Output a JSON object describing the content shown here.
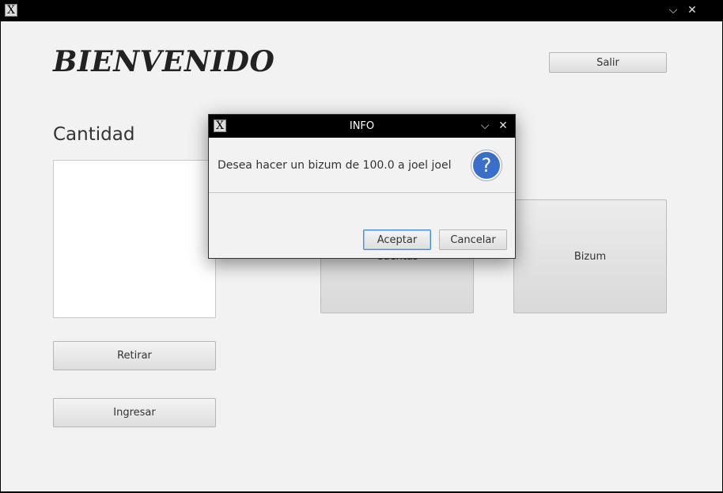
{
  "window": {
    "app_icon": "x11-logo-icon",
    "controls": [
      "chevron-down-icon",
      "close-icon"
    ]
  },
  "main": {
    "heading": "BIENVENIDO",
    "salir_label": "Salir",
    "cantidad_label": "Cantidad",
    "cantidad_value": "",
    "retirar_label": "Retirar",
    "ingresar_label": "Ingresar",
    "cuentas_label": "Cuentas",
    "bizum_label": "Bizum"
  },
  "dialog": {
    "title": "INFO",
    "message": "Desea hacer un bizum de 100.0 a joel joel",
    "icon": "question-icon",
    "accept_label": "Aceptar",
    "cancel_label": "Cancelar",
    "question_glyph": "?",
    "icon_color": "#3a6fc9"
  },
  "glyphs": {
    "x_logo": "X",
    "minimize": "⌵",
    "close": "✕"
  }
}
